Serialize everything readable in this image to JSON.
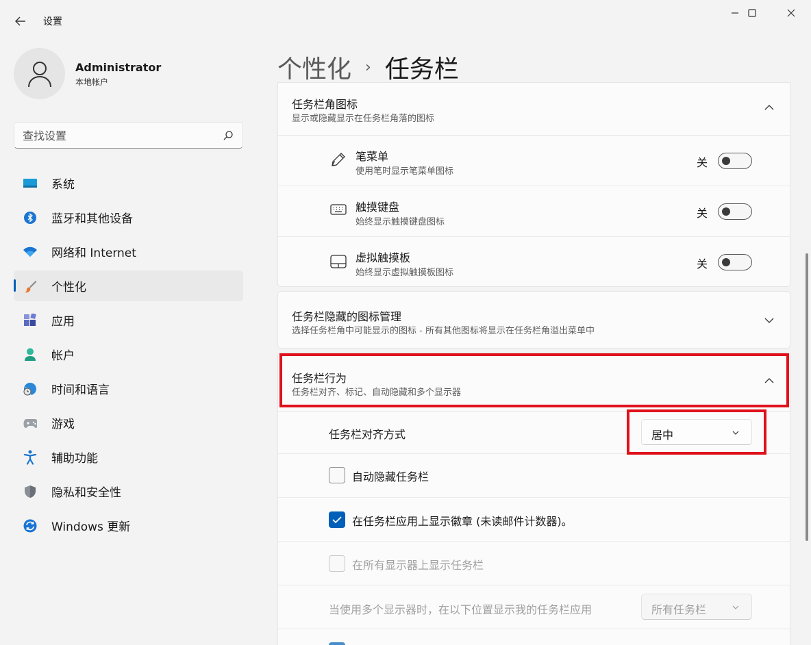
{
  "window": {
    "title": "设置"
  },
  "user": {
    "name": "Administrator",
    "account_type": "本地帐户"
  },
  "search": {
    "placeholder": "查找设置"
  },
  "sidebar": {
    "items": [
      {
        "label": "系统",
        "icon": "system-icon"
      },
      {
        "label": "蓝牙和其他设备",
        "icon": "bluetooth-icon"
      },
      {
        "label": "网络和 Internet",
        "icon": "wifi-icon"
      },
      {
        "label": "个性化",
        "icon": "brush-icon",
        "active": true
      },
      {
        "label": "应用",
        "icon": "apps-icon"
      },
      {
        "label": "帐户",
        "icon": "account-icon"
      },
      {
        "label": "时间和语言",
        "icon": "globe-clock-icon"
      },
      {
        "label": "游戏",
        "icon": "gamepad-icon"
      },
      {
        "label": "辅助功能",
        "icon": "accessibility-icon"
      },
      {
        "label": "隐私和安全性",
        "icon": "shield-icon"
      },
      {
        "label": "Windows 更新",
        "icon": "update-icon"
      }
    ]
  },
  "breadcrumb": {
    "parent": "个性化",
    "separator": "›",
    "current": "任务栏"
  },
  "corner_icons": {
    "title": "任务栏角图标",
    "desc": "显示或隐藏显示在任务栏角落的图标",
    "items": [
      {
        "title": "笔菜单",
        "desc": "使用笔时显示笔菜单图标",
        "state": "关",
        "icon": "pen-icon"
      },
      {
        "title": "触摸键盘",
        "desc": "始终显示触摸键盘图标",
        "state": "关",
        "icon": "keyboard-icon"
      },
      {
        "title": "虚拟触摸板",
        "desc": "始终显示虚拟触摸板图标",
        "state": "关",
        "icon": "touchpad-icon"
      }
    ]
  },
  "hidden_icons": {
    "title": "任务栏隐藏的图标管理",
    "desc": "选择任务栏角中可能显示的图标 - 所有其他图标将显示在任务栏角溢出菜单中"
  },
  "behaviors": {
    "title": "任务栏行为",
    "desc": "任务栏对齐、标记、自动隐藏和多个显示器",
    "alignment_label": "任务栏对齐方式",
    "alignment_value": "居中",
    "auto_hide": {
      "label": "自动隐藏任务栏",
      "checked": false
    },
    "badges": {
      "label": "在任务栏应用上显示徽章 (未读邮件计数器)。",
      "checked": true
    },
    "all_displays": {
      "label": "在所有显示器上显示任务栏",
      "checked": false,
      "disabled": true
    },
    "multi_display_label": "当使用多个显示器时，在以下位置显示我的任务栏应用",
    "multi_display_value": "所有任务栏"
  },
  "colors": {
    "accent": "#005fb8",
    "highlight": "#e0111b"
  }
}
